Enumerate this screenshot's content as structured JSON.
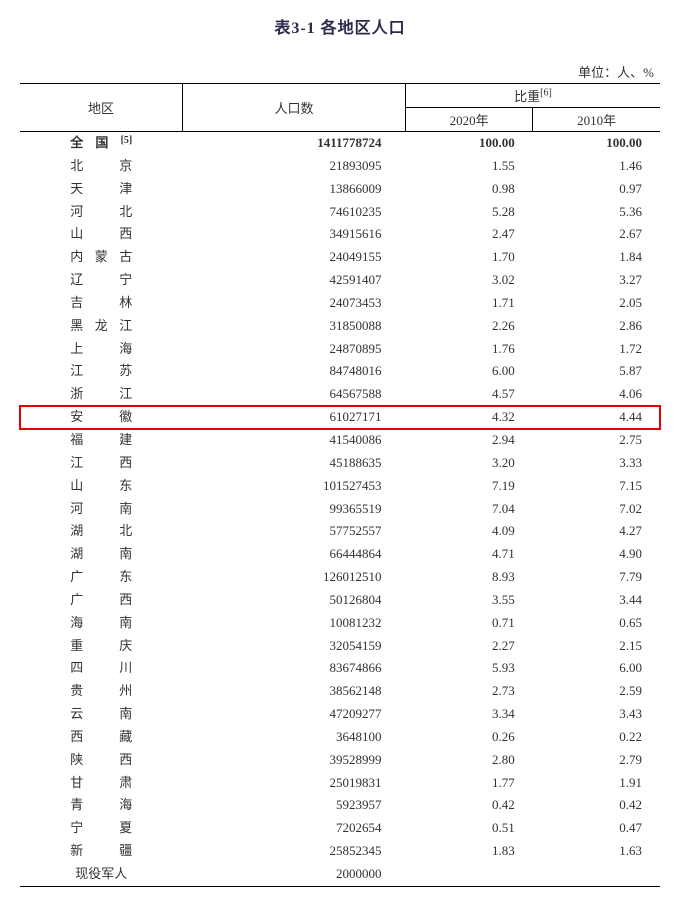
{
  "title": "表3-1 各地区人口",
  "unit_label": "单位：人、%",
  "headers": {
    "region": "地区",
    "population": "人口数",
    "weight": "比重",
    "weight_sup": "[6]",
    "year2020": "2020年",
    "year2010": "2010年"
  },
  "total_row": {
    "region_chars": [
      "全",
      "国"
    ],
    "sup": "[5]",
    "population": "1411778724",
    "w2020": "100.00",
    "w2010": "100.00"
  },
  "highlight_index": 11,
  "rows": [
    {
      "region_chars": [
        "北",
        "京"
      ],
      "population": "21893095",
      "w2020": "1.55",
      "w2010": "1.46"
    },
    {
      "region_chars": [
        "天",
        "津"
      ],
      "population": "13866009",
      "w2020": "0.98",
      "w2010": "0.97"
    },
    {
      "region_chars": [
        "河",
        "北"
      ],
      "population": "74610235",
      "w2020": "5.28",
      "w2010": "5.36"
    },
    {
      "region_chars": [
        "山",
        "西"
      ],
      "population": "34915616",
      "w2020": "2.47",
      "w2010": "2.67"
    },
    {
      "region_chars": [
        "内",
        "蒙",
        "古"
      ],
      "population": "24049155",
      "w2020": "1.70",
      "w2010": "1.84"
    },
    {
      "region_chars": [
        "辽",
        "宁"
      ],
      "population": "42591407",
      "w2020": "3.02",
      "w2010": "3.27"
    },
    {
      "region_chars": [
        "吉",
        "林"
      ],
      "population": "24073453",
      "w2020": "1.71",
      "w2010": "2.05"
    },
    {
      "region_chars": [
        "黑",
        "龙",
        "江"
      ],
      "population": "31850088",
      "w2020": "2.26",
      "w2010": "2.86"
    },
    {
      "region_chars": [
        "上",
        "海"
      ],
      "population": "24870895",
      "w2020": "1.76",
      "w2010": "1.72"
    },
    {
      "region_chars": [
        "江",
        "苏"
      ],
      "population": "84748016",
      "w2020": "6.00",
      "w2010": "5.87"
    },
    {
      "region_chars": [
        "浙",
        "江"
      ],
      "population": "64567588",
      "w2020": "4.57",
      "w2010": "4.06"
    },
    {
      "region_chars": [
        "安",
        "徽"
      ],
      "population": "61027171",
      "w2020": "4.32",
      "w2010": "4.44"
    },
    {
      "region_chars": [
        "福",
        "建"
      ],
      "population": "41540086",
      "w2020": "2.94",
      "w2010": "2.75"
    },
    {
      "region_chars": [
        "江",
        "西"
      ],
      "population": "45188635",
      "w2020": "3.20",
      "w2010": "3.33"
    },
    {
      "region_chars": [
        "山",
        "东"
      ],
      "population": "101527453",
      "w2020": "7.19",
      "w2010": "7.15"
    },
    {
      "region_chars": [
        "河",
        "南"
      ],
      "population": "99365519",
      "w2020": "7.04",
      "w2010": "7.02"
    },
    {
      "region_chars": [
        "湖",
        "北"
      ],
      "population": "57752557",
      "w2020": "4.09",
      "w2010": "4.27"
    },
    {
      "region_chars": [
        "湖",
        "南"
      ],
      "population": "66444864",
      "w2020": "4.71",
      "w2010": "4.90"
    },
    {
      "region_chars": [
        "广",
        "东"
      ],
      "population": "126012510",
      "w2020": "8.93",
      "w2010": "7.79"
    },
    {
      "region_chars": [
        "广",
        "西"
      ],
      "population": "50126804",
      "w2020": "3.55",
      "w2010": "3.44"
    },
    {
      "region_chars": [
        "海",
        "南"
      ],
      "population": "10081232",
      "w2020": "0.71",
      "w2010": "0.65"
    },
    {
      "region_chars": [
        "重",
        "庆"
      ],
      "population": "32054159",
      "w2020": "2.27",
      "w2010": "2.15"
    },
    {
      "region_chars": [
        "四",
        "川"
      ],
      "population": "83674866",
      "w2020": "5.93",
      "w2010": "6.00"
    },
    {
      "region_chars": [
        "贵",
        "州"
      ],
      "population": "38562148",
      "w2020": "2.73",
      "w2010": "2.59"
    },
    {
      "region_chars": [
        "云",
        "南"
      ],
      "population": "47209277",
      "w2020": "3.34",
      "w2010": "3.43"
    },
    {
      "region_chars": [
        "西",
        "藏"
      ],
      "population": "3648100",
      "w2020": "0.26",
      "w2010": "0.22"
    },
    {
      "region_chars": [
        "陕",
        "西"
      ],
      "population": "39528999",
      "w2020": "2.80",
      "w2010": "2.79"
    },
    {
      "region_chars": [
        "甘",
        "肃"
      ],
      "population": "25019831",
      "w2020": "1.77",
      "w2010": "1.91"
    },
    {
      "region_chars": [
        "青",
        "海"
      ],
      "population": "5923957",
      "w2020": "0.42",
      "w2010": "0.42"
    },
    {
      "region_chars": [
        "宁",
        "夏"
      ],
      "population": "7202654",
      "w2020": "0.51",
      "w2010": "0.47"
    },
    {
      "region_chars": [
        "新",
        "疆"
      ],
      "population": "25852345",
      "w2020": "1.83",
      "w2010": "1.63"
    },
    {
      "region_chars": [
        "现役军人"
      ],
      "population": "2000000",
      "w2020": "",
      "w2010": "",
      "no_spread": true
    }
  ]
}
